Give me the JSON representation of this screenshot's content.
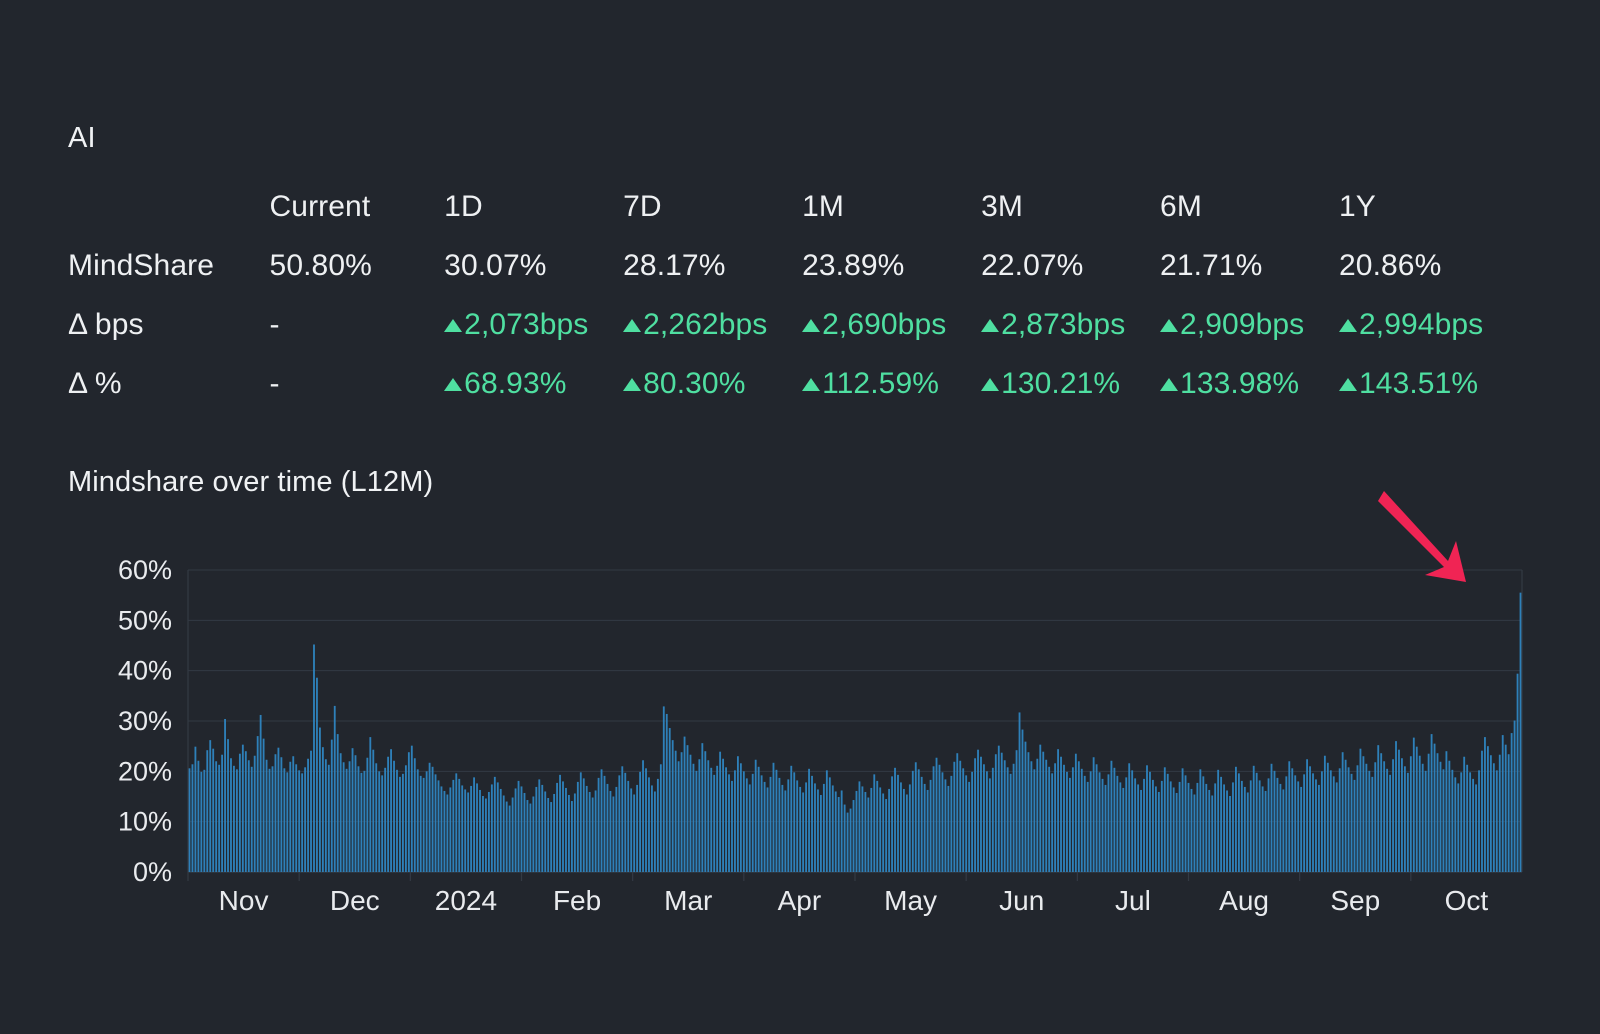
{
  "entity": {
    "title": "AI"
  },
  "metrics": {
    "columns": [
      "Current",
      "1D",
      "7D",
      "1M",
      "3M",
      "6M",
      "1Y"
    ],
    "rows": [
      {
        "label": "MindShare",
        "kind": "value",
        "values": [
          "50.80%",
          "30.07%",
          "28.17%",
          "23.89%",
          "22.07%",
          "21.71%",
          "20.86%"
        ]
      },
      {
        "label": "Δ bps",
        "kind": "delta",
        "values": [
          "-",
          "2,073bps",
          "2,262bps",
          "2,690bps",
          "2,873bps",
          "2,909bps",
          "2,994bps"
        ],
        "directions": [
          "none",
          "up",
          "up",
          "up",
          "up",
          "up",
          "up"
        ]
      },
      {
        "label": "Δ %",
        "kind": "delta",
        "values": [
          "-",
          "68.93%",
          "80.30%",
          "112.59%",
          "130.21%",
          "133.98%",
          "143.51%"
        ],
        "directions": [
          "none",
          "up",
          "up",
          "up",
          "up",
          "up",
          "up"
        ]
      }
    ]
  },
  "colors": {
    "background": "#22262d",
    "text": "#eef0f2",
    "positive_green": "#4fdfa1",
    "bar_blue": "#2e80b9",
    "gridline": "#333a44",
    "annotation_arrow": "#f02454"
  },
  "annotation": {
    "type": "arrow",
    "points_to": "latest-spike-bar",
    "color": "#f02454"
  },
  "chart_data": {
    "type": "bar",
    "title": "Mindshare over time (L12M)",
    "xlabel": "",
    "ylabel": "",
    "ylim": [
      0,
      60
    ],
    "ytick_labels": [
      "0%",
      "10%",
      "20%",
      "30%",
      "40%",
      "50%",
      "60%"
    ],
    "ytick_values": [
      0,
      10,
      20,
      30,
      40,
      50,
      60
    ],
    "grid": true,
    "legend": "none",
    "xtick_labels": [
      "Nov",
      "Dec",
      "2024",
      "Feb",
      "Mar",
      "Apr",
      "May",
      "Jun",
      "Jul",
      "Aug",
      "Sep",
      "Oct"
    ],
    "series_name": "MindShare",
    "units": "percent",
    "frequency": "daily",
    "latest_value": 50.8,
    "peak_value": 55.5,
    "values": [
      20.6,
      21.4,
      24.9,
      22.1,
      19.9,
      20.3,
      24.2,
      26.2,
      24.5,
      22.0,
      21.3,
      23.3,
      30.4,
      26.4,
      22.6,
      21.1,
      20.4,
      23.5,
      25.3,
      24.0,
      22.2,
      20.9,
      23.1,
      27.0,
      31.2,
      26.5,
      22.3,
      20.5,
      21.0,
      23.4,
      24.7,
      22.8,
      20.6,
      19.8,
      21.9,
      23.0,
      21.4,
      20.2,
      19.6,
      20.8,
      22.5,
      24.1,
      45.2,
      38.6,
      28.7,
      24.8,
      22.4,
      21.3,
      26.3,
      33.0,
      27.4,
      23.6,
      21.8,
      20.5,
      22.0,
      24.6,
      23.2,
      21.0,
      19.7,
      20.1,
      22.7,
      26.8,
      24.3,
      21.6,
      20.0,
      19.2,
      20.7,
      22.9,
      24.4,
      22.1,
      20.3,
      18.9,
      19.5,
      21.2,
      23.8,
      25.1,
      22.6,
      20.4,
      19.1,
      18.7,
      20.0,
      21.7,
      20.9,
      19.4,
      18.2,
      17.0,
      16.1,
      15.4,
      16.8,
      18.3,
      19.6,
      18.5,
      17.2,
      16.4,
      15.8,
      17.1,
      18.8,
      17.6,
      16.3,
      15.1,
      14.6,
      15.9,
      17.4,
      18.9,
      17.8,
      16.5,
      15.2,
      14.0,
      13.2,
      14.8,
      16.6,
      18.1,
      17.0,
      15.7,
      14.3,
      13.6,
      15.0,
      16.9,
      18.4,
      17.3,
      16.0,
      14.7,
      13.9,
      15.5,
      17.7,
      19.3,
      18.0,
      16.7,
      15.3,
      14.1,
      15.6,
      17.9,
      19.8,
      18.6,
      17.1,
      15.9,
      14.8,
      16.2,
      18.7,
      20.4,
      19.1,
      17.5,
      16.1,
      15.0,
      16.9,
      19.2,
      21.0,
      19.7,
      18.1,
      16.6,
      15.4,
      17.3,
      19.9,
      22.2,
      20.6,
      18.8,
      17.2,
      16.0,
      18.5,
      21.4,
      32.9,
      31.4,
      28.6,
      26.2,
      24.1,
      22.0,
      23.8,
      26.9,
      25.2,
      23.3,
      21.5,
      20.1,
      22.4,
      25.6,
      24.0,
      22.2,
      20.7,
      19.3,
      21.1,
      23.9,
      22.5,
      20.8,
      19.4,
      18.1,
      20.2,
      23.0,
      21.6,
      20.0,
      18.6,
      17.4,
      19.5,
      22.3,
      20.9,
      19.2,
      17.9,
      16.8,
      18.9,
      21.7,
      20.3,
      18.7,
      17.3,
      16.2,
      18.4,
      21.1,
      19.8,
      18.2,
      16.9,
      15.8,
      17.8,
      20.5,
      19.1,
      17.6,
      16.4,
      15.3,
      17.5,
      20.2,
      18.8,
      17.2,
      16.0,
      14.9,
      16.2,
      13.4,
      11.8,
      12.6,
      14.3,
      16.1,
      18.0,
      17.0,
      15.9,
      14.8,
      16.7,
      19.4,
      18.1,
      16.8,
      15.6,
      14.5,
      16.5,
      19.0,
      20.7,
      19.3,
      17.8,
      16.5,
      15.4,
      17.4,
      20.1,
      21.8,
      20.4,
      18.9,
      17.5,
      16.3,
      18.3,
      21.0,
      22.7,
      21.3,
      19.8,
      18.4,
      17.1,
      19.1,
      21.9,
      23.6,
      22.1,
      20.6,
      19.2,
      17.9,
      19.9,
      22.6,
      24.3,
      22.9,
      21.4,
      20.0,
      18.6,
      20.7,
      23.4,
      25.1,
      23.7,
      22.2,
      20.8,
      19.5,
      21.5,
      24.2,
      31.7,
      28.3,
      25.9,
      23.8,
      22.0,
      20.4,
      22.5,
      25.3,
      23.9,
      22.3,
      20.9,
      19.6,
      21.6,
      24.4,
      22.9,
      21.3,
      19.9,
      18.7,
      20.8,
      23.5,
      22.0,
      20.5,
      19.1,
      17.9,
      20.0,
      22.8,
      21.4,
      19.8,
      18.5,
      17.3,
      19.4,
      22.1,
      20.7,
      19.1,
      17.8,
      16.7,
      18.8,
      21.6,
      20.2,
      18.6,
      17.4,
      16.3,
      18.5,
      21.2,
      19.9,
      18.3,
      17.0,
      15.9,
      18.1,
      20.8,
      19.5,
      18.0,
      16.8,
      15.7,
      17.9,
      20.6,
      19.2,
      17.7,
      16.5,
      15.4,
      17.7,
      20.4,
      19.0,
      17.5,
      16.3,
      15.2,
      17.6,
      20.3,
      18.9,
      17.4,
      16.2,
      15.1,
      17.8,
      20.9,
      19.6,
      18.1,
      16.9,
      15.8,
      18.2,
      21.1,
      19.7,
      18.2,
      17.0,
      16.1,
      18.6,
      21.5,
      20.1,
      18.7,
      17.5,
      16.4,
      19.0,
      22.0,
      20.6,
      19.2,
      18.0,
      16.9,
      19.4,
      22.4,
      21.0,
      19.6,
      18.4,
      17.3,
      20.0,
      23.1,
      21.7,
      20.2,
      19.0,
      17.8,
      20.6,
      23.8,
      22.3,
      20.8,
      19.5,
      18.3,
      21.2,
      24.5,
      23.0,
      21.5,
      20.1,
      18.9,
      21.8,
      25.2,
      23.6,
      22.0,
      20.5,
      19.3,
      22.4,
      26.0,
      24.3,
      22.6,
      21.0,
      19.7,
      23.0,
      26.7,
      24.9,
      23.1,
      21.5,
      20.1,
      23.5,
      27.4,
      25.5,
      23.6,
      21.9,
      20.4,
      24.0,
      22.1,
      20.3,
      18.8,
      17.6,
      19.8,
      22.9,
      21.3,
      19.8,
      18.5,
      17.4,
      20.2,
      24.1,
      26.8,
      25.0,
      23.2,
      21.6,
      20.2,
      23.3,
      27.2,
      25.3,
      23.4,
      27.6,
      30.1,
      39.4,
      55.5
    ]
  }
}
